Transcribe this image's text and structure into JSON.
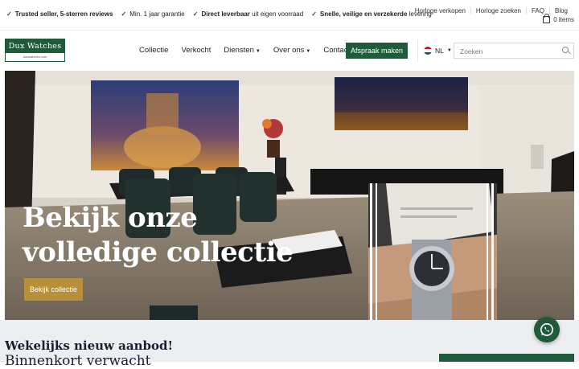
{
  "topbar": {
    "usps": [
      {
        "bold": "Trusted seller, 5-sterren reviews",
        "rest": ""
      },
      {
        "bold": "",
        "rest": "Min. 1 jaar garantie"
      },
      {
        "bold": "Direct leverbaar",
        "rest": " uit eigen voorraad"
      },
      {
        "bold": "Snelle, veilige en verzekerde",
        "rest": " levering"
      }
    ],
    "links": [
      "Horloge verkopen",
      "Horloge zoeken",
      "FAQ",
      "Blog"
    ],
    "cart_label": "0 items"
  },
  "logo": {
    "title": "Dux Watches",
    "subtitle": "duxwatches.com"
  },
  "nav": {
    "items": [
      "Collectie",
      "Verkocht",
      "Diensten",
      "Over ons",
      "Contact"
    ],
    "appointment_button": "Afspraak maken",
    "language": "NL",
    "search_placeholder": "Zoeken"
  },
  "hero": {
    "title_line1": "Bekijk onze",
    "title_line2": "volledige collectie",
    "button": "Bekijk collectie"
  },
  "section": {
    "kicker": "Wekelijks nieuw aanbod!",
    "heading": "Binnenkort verwacht"
  },
  "colors": {
    "brand_green": "#1f5a3a",
    "gold": "#b8903a",
    "navy": "#1c1c2e"
  }
}
